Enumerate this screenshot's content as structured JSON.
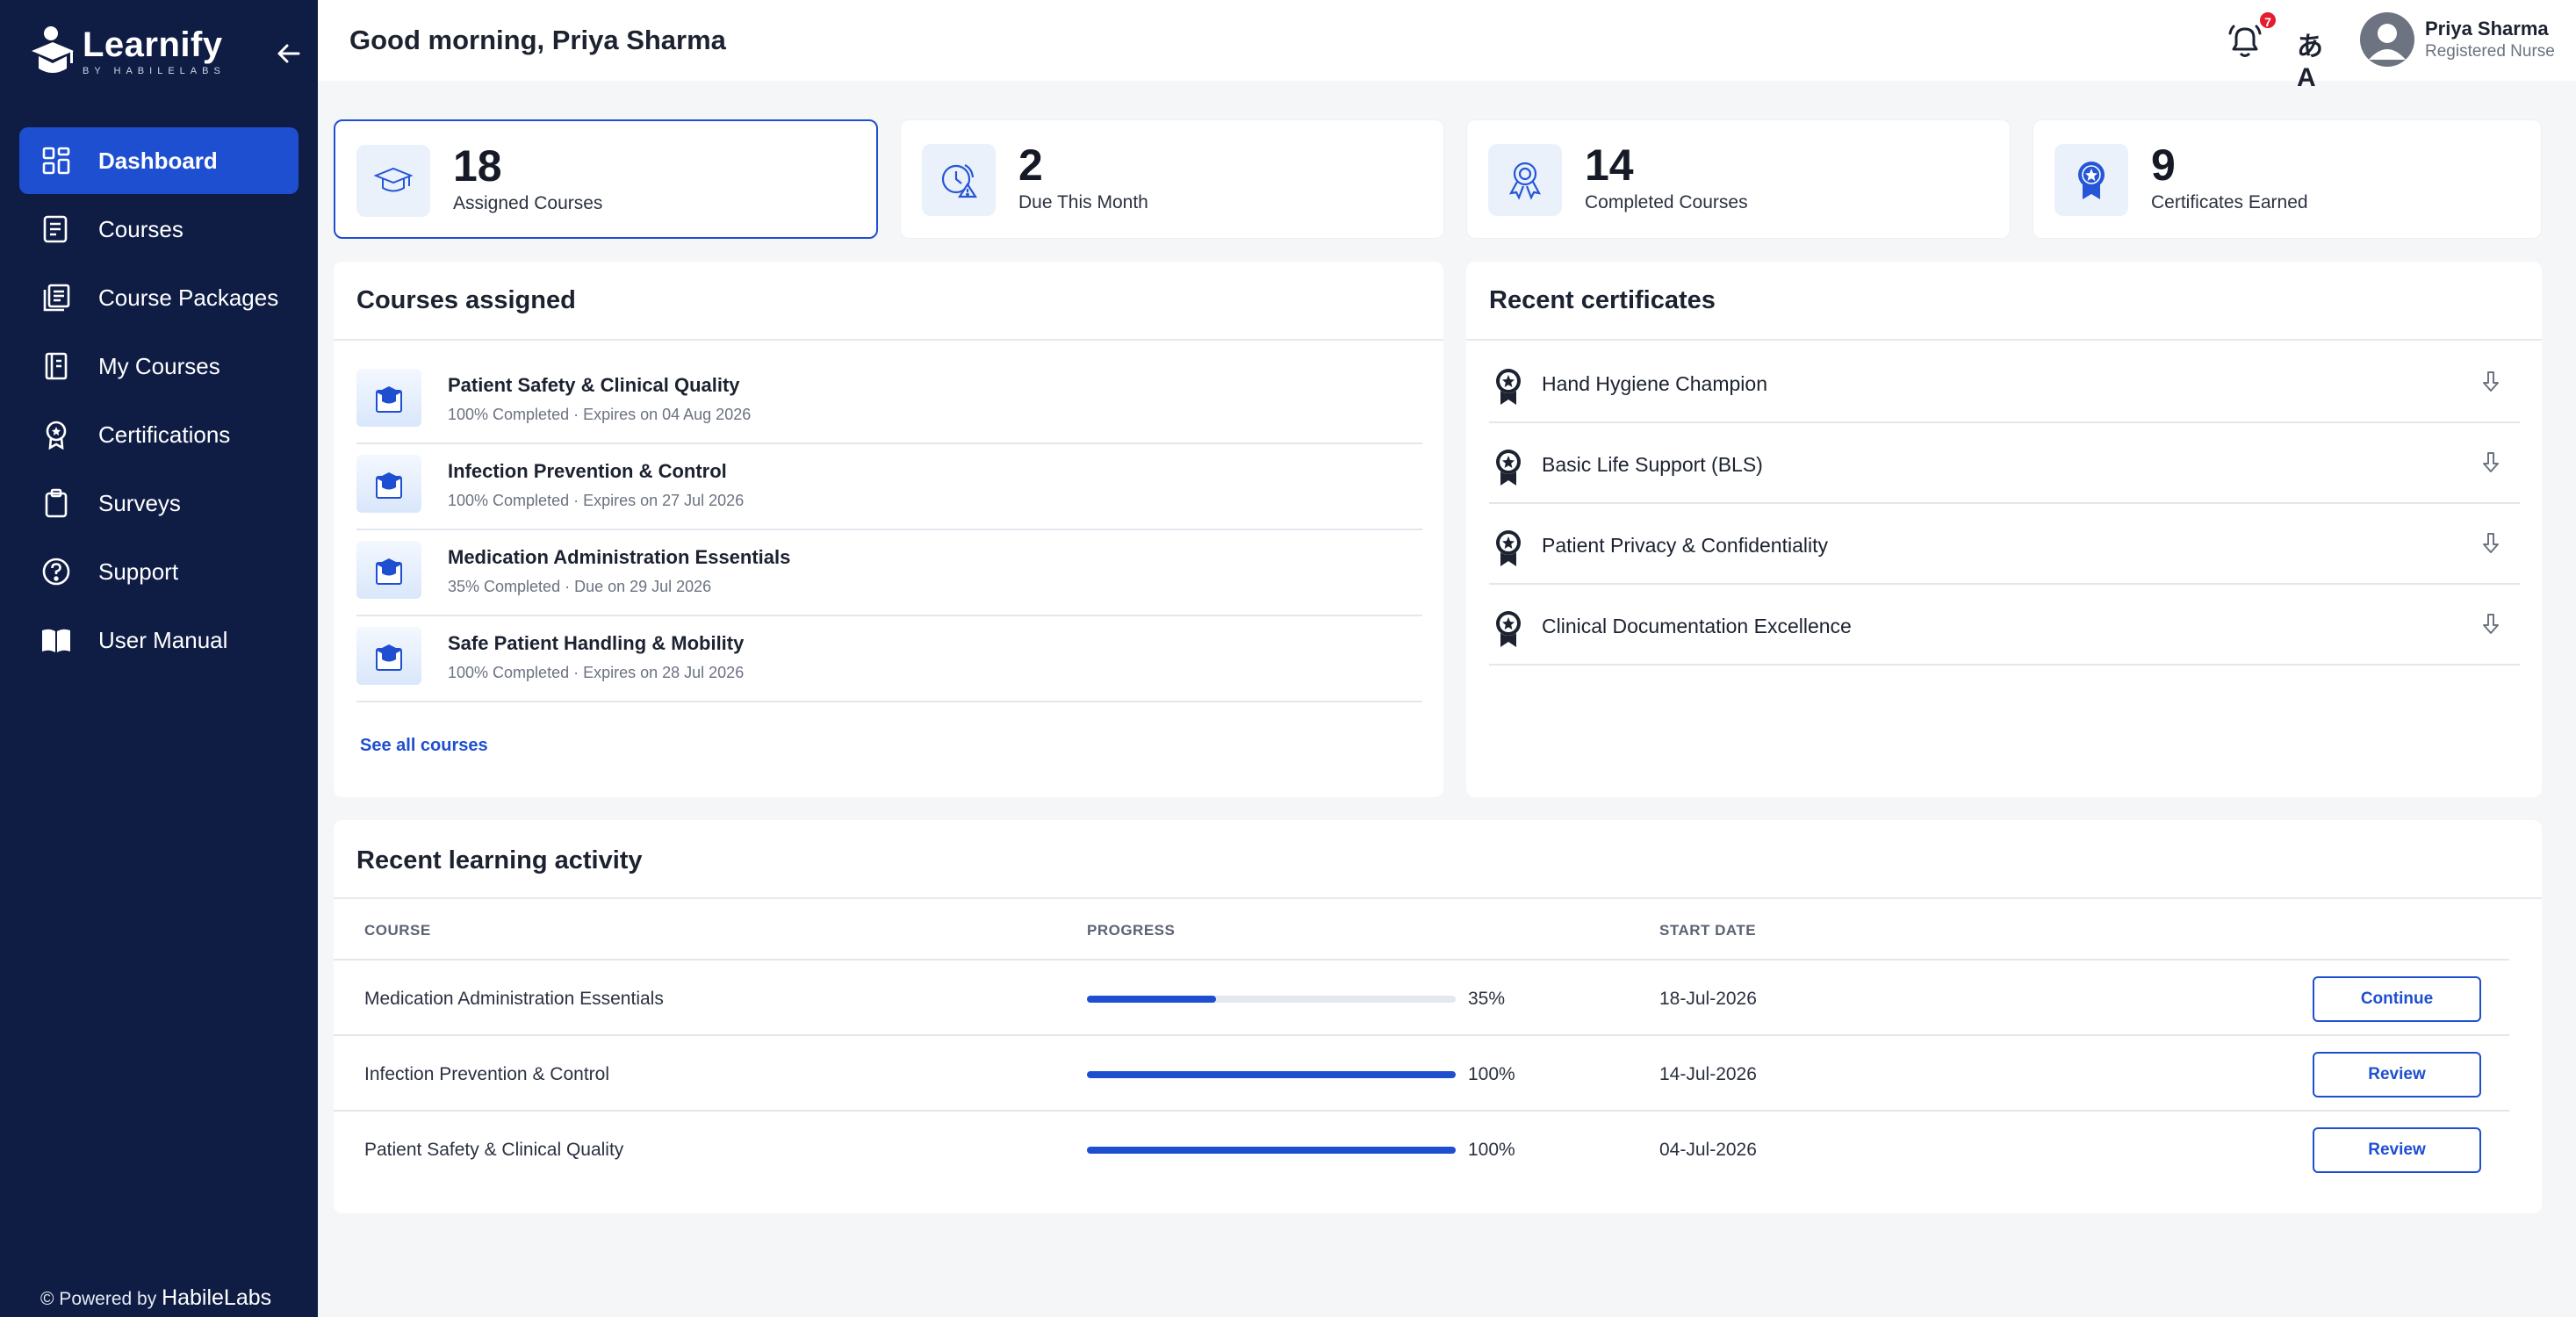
{
  "app": {
    "name": "Learnify",
    "tagline": "BY HABILELABS",
    "powered_prefix": "© Powered by",
    "powered_brand": "HabileLabs"
  },
  "sidebar": {
    "items": [
      {
        "label": "Dashboard",
        "icon": "dashboard-icon",
        "active": true
      },
      {
        "label": "Courses",
        "icon": "courses-icon"
      },
      {
        "label": "Course Packages",
        "icon": "packages-icon"
      },
      {
        "label": "My Courses",
        "icon": "my-courses-icon"
      },
      {
        "label": "Certifications",
        "icon": "certificate-icon"
      },
      {
        "label": "Surveys",
        "icon": "clipboard-icon"
      },
      {
        "label": "Support",
        "icon": "help-icon"
      },
      {
        "label": "User Manual",
        "icon": "book-icon"
      }
    ]
  },
  "header": {
    "greeting": "Good morning, Priya Sharma",
    "notifications_count": "7",
    "translate_glyph": "あA",
    "user_name": "Priya Sharma",
    "user_role": "Registered Nurse"
  },
  "stats": [
    {
      "value": "18",
      "label": "Assigned Courses"
    },
    {
      "value": "2",
      "label": "Due This Month"
    },
    {
      "value": "14",
      "label": "Completed Courses"
    },
    {
      "value": "9",
      "label": "Certificates Earned"
    }
  ],
  "courses_assigned": {
    "title": "Courses assigned",
    "items": [
      {
        "name": "Patient Safety & Clinical Quality",
        "meta": "100% Completed · Expires on 04 Aug 2026"
      },
      {
        "name": "Infection Prevention & Control",
        "meta": "100% Completed · Expires on 27 Jul 2026"
      },
      {
        "name": "Medication Administration Essentials",
        "meta": "35% Completed · Due on 29 Jul 2026"
      },
      {
        "name": "Safe Patient Handling & Mobility",
        "meta": "100% Completed · Expires on 28 Jul 2026"
      }
    ],
    "see_all": "See all courses"
  },
  "recent_certificates": {
    "title": "Recent certificates",
    "items": [
      {
        "name": "Hand Hygiene Champion"
      },
      {
        "name": "Basic Life Support (BLS)"
      },
      {
        "name": "Patient Privacy & Confidentiality"
      },
      {
        "name": "Clinical Documentation Excellence"
      }
    ]
  },
  "activity": {
    "title": "Recent learning activity",
    "columns": {
      "course": "COURSE",
      "progress": "PROGRESS",
      "start_date": "START DATE"
    },
    "rows": [
      {
        "course": "Medication Administration Essentials",
        "progress": 35,
        "progress_label": "35%",
        "start_date": "18-Jul-2026",
        "action": "Continue"
      },
      {
        "course": "Infection Prevention & Control",
        "progress": 100,
        "progress_label": "100%",
        "start_date": "14-Jul-2026",
        "action": "Review"
      },
      {
        "course": "Patient Safety & Clinical Quality",
        "progress": 100,
        "progress_label": "100%",
        "start_date": "04-Jul-2026",
        "action": "Review"
      }
    ]
  },
  "colors": {
    "sidebar_bg": "#0f1d45",
    "accent": "#1e4fd0",
    "badge": "#e11d2e"
  }
}
